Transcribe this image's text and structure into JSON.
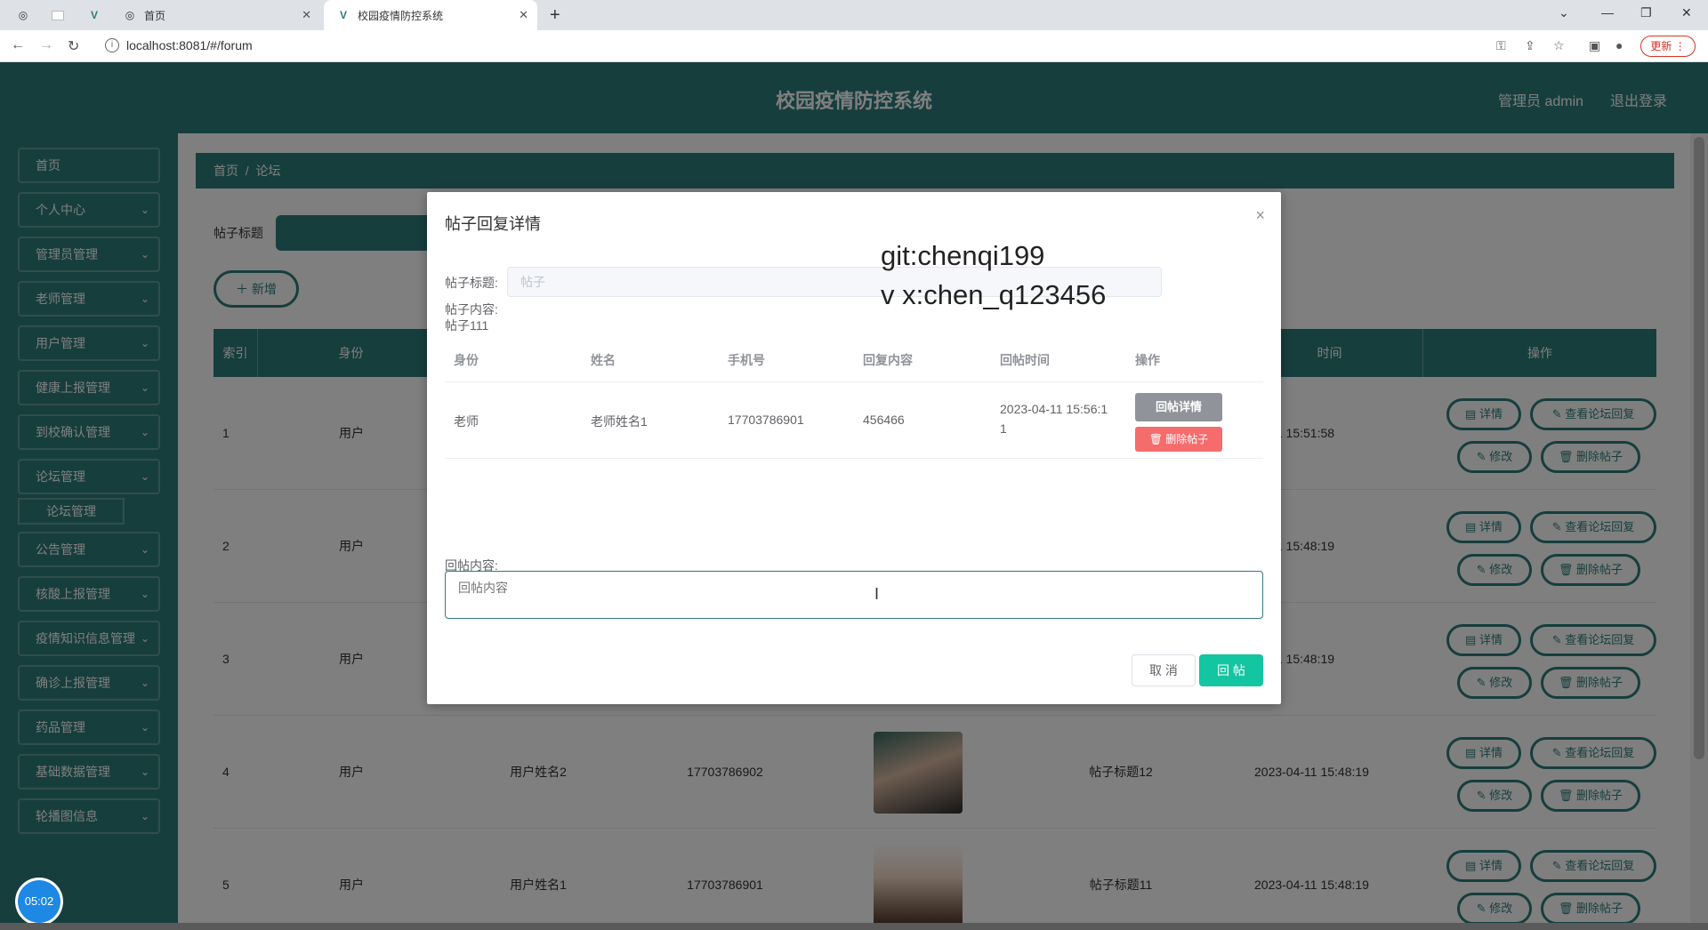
{
  "browser": {
    "tabs": [
      {
        "title": ""
      },
      {
        "title": ""
      },
      {
        "title": ""
      },
      {
        "title": "首页"
      },
      {
        "title": "校园疫情防控系统"
      }
    ],
    "url": "localhost:8081/#/forum",
    "update_label": "更新"
  },
  "header": {
    "title": "校园疫情防控系统",
    "admin": "管理员 admin",
    "logout": "退出登录"
  },
  "sidebar": {
    "items": [
      {
        "label": "首页"
      },
      {
        "label": "个人中心"
      },
      {
        "label": "管理员管理"
      },
      {
        "label": "老师管理"
      },
      {
        "label": "用户管理"
      },
      {
        "label": "健康上报管理"
      },
      {
        "label": "到校确认管理"
      },
      {
        "label": "论坛管理"
      },
      {
        "label": "公告管理"
      },
      {
        "label": "核酸上报管理"
      },
      {
        "label": "疫情知识信息管理"
      },
      {
        "label": "确诊上报管理"
      },
      {
        "label": "药品管理"
      },
      {
        "label": "基础数据管理"
      },
      {
        "label": "轮播图信息"
      }
    ],
    "sub_active": "论坛管理",
    "clock": "05:02"
  },
  "main": {
    "breadcrumb_home": "首页",
    "breadcrumb_sep": "/",
    "breadcrumb_current": "论坛",
    "search_label": "帖子标题",
    "add_label": "＋ 新增",
    "columns": [
      "索引",
      "身份",
      "时间",
      "操作"
    ],
    "rows": [
      {
        "index": "1",
        "role": "用户",
        "name": "",
        "phone": "",
        "title": "",
        "time": "-4-11 15:51:58"
      },
      {
        "index": "2",
        "role": "用户",
        "name": "",
        "phone": "",
        "title": "",
        "time": "-4-11 15:48:19"
      },
      {
        "index": "3",
        "role": "用户",
        "name": "",
        "phone": "",
        "title": "",
        "time": "-4-11 15:48:19"
      },
      {
        "index": "4",
        "role": "用户",
        "name": "用户姓名2",
        "phone": "17703786902",
        "title": "帖子标题12",
        "time": "2023-04-11 15:48:19"
      },
      {
        "index": "5",
        "role": "用户",
        "name": "用户姓名1",
        "phone": "17703786901",
        "title": "帖子标题11",
        "time": "2023-04-11 15:48:19"
      }
    ],
    "ops": {
      "detail": "详情",
      "view_reply": "查看论坛回复",
      "edit": "修改",
      "delete": "删除帖子"
    }
  },
  "dialog": {
    "title": "帖子回复详情",
    "close": "×",
    "post_title_label": "帖子标题:",
    "post_title_placeholder": "帖子",
    "post_content_label": "帖子内容:",
    "post_content_value": "帖子111",
    "watermark_line1": "git:chenqi199",
    "watermark_line2": "v x:chen_q123456",
    "reply_columns": [
      "身份",
      "姓名",
      "手机号",
      "回复内容",
      "回帖时间",
      "操作"
    ],
    "reply_row": {
      "role": "老师",
      "name": "老师姓名1",
      "phone": "17703786901",
      "content": "456466",
      "time_line1": "2023-04-11 15:56:1",
      "time_line2": "1",
      "detail_btn": "回帖详情",
      "delete_btn": "删除帖子"
    },
    "reply_label": "回帖内容:",
    "reply_placeholder": "回帖内容",
    "cancel": "取 消",
    "submit": "回 帖"
  },
  "colors": {
    "primary": "#2d7d7a",
    "submit": "#13c5a0",
    "danger": "#f56c6c",
    "info": "#909399"
  }
}
